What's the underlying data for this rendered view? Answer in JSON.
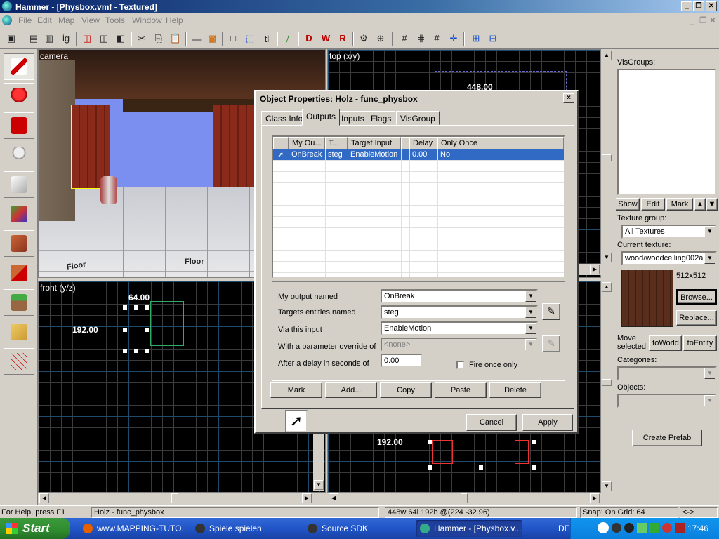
{
  "window": {
    "title": "Hammer - [Physbox.vmf - Textured]"
  },
  "menu": [
    "File",
    "Edit",
    "Map",
    "View",
    "Tools",
    "Window",
    "Help"
  ],
  "viewports": {
    "camera": {
      "label": "camera",
      "floor_label": "Floor"
    },
    "top": {
      "label": "top (x/y)",
      "dim": "448.00"
    },
    "front": {
      "label": "front (y/z)",
      "dim_w": "64.00",
      "dim_h": "192.00"
    },
    "side": {
      "dim_h": "192.00"
    }
  },
  "right_panel": {
    "visgroups_label": "VisGroups:",
    "show": "Show",
    "edit": "Edit",
    "mark": "Mark",
    "up_icon": "▲",
    "down_icon": "▼",
    "texture_group_label": "Texture group:",
    "texture_group_value": "All Textures",
    "current_texture_label": "Current texture:",
    "current_texture_value": "wood/woodceiling002a",
    "texture_size": "512x512",
    "browse": "Browse...",
    "replace": "Replace...",
    "move_selected": "Move selected:",
    "to_world": "toWorld",
    "to_entity": "toEntity",
    "categories_label": "Categories:",
    "objects_label": "Objects:",
    "create_prefab": "Create Prefab"
  },
  "dialog": {
    "title": "Object Properties: Holz - func_physbox",
    "close": "×",
    "tabs": [
      "Class Info",
      "Outputs",
      "Inputs",
      "Flags",
      "VisGroup"
    ],
    "active_tab": "Outputs",
    "columns": [
      "My Ou...",
      "T...",
      "Target Input",
      "Delay",
      "Only Once"
    ],
    "rows": [
      {
        "output": "OnBreak",
        "target": "steg",
        "input": "EnableMotion",
        "delay": "0.00",
        "once": "No"
      }
    ],
    "fields": {
      "output_label": "My output named",
      "output_value": "OnBreak",
      "targets_label": "Targets entities named",
      "targets_value": "steg",
      "input_label": "Via this input",
      "input_value": "EnableMotion",
      "param_label": "With a parameter override of",
      "param_value": "<none>",
      "delay_label": "After a delay in seconds of",
      "delay_value": "0.00",
      "fire_once_label": "Fire once only"
    },
    "buttons": {
      "mark": "Mark",
      "add": "Add...",
      "copy": "Copy",
      "paste": "Paste",
      "delete": "Delete",
      "cancel": "Cancel",
      "apply": "Apply"
    }
  },
  "status": {
    "help": "For Help, press F1",
    "selection": "Holz - func_physbox",
    "size": "448w 64l 192h @(224 -32 96)",
    "snap": "Snap: On Grid: 64",
    "arrows": "<->"
  },
  "taskbar": {
    "start": "Start",
    "tasks": [
      "www.MAPPING-TUTO...",
      "Spiele spielen",
      "Source SDK",
      "Hammer - [Physbox.v..."
    ],
    "lang": "DE",
    "clock": "17:46"
  }
}
